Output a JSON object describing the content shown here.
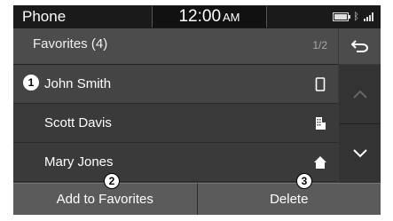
{
  "status_bar": {
    "title": "Phone",
    "time": "12:00",
    "ampm": "AM",
    "icons": [
      "battery-icon",
      "bluetooth-icon",
      "signal-icon"
    ]
  },
  "header": {
    "title": "Favorites (4)",
    "page_indicator": "1/2",
    "back_icon": "back-arrow-icon"
  },
  "contacts": [
    {
      "name": "John Smith",
      "type_icon": "mobile-phone-icon",
      "selected": true
    },
    {
      "name": "Scott Davis",
      "type_icon": "office-building-icon"
    },
    {
      "name": "Mary Jones",
      "type_icon": "home-icon"
    }
  ],
  "scroll": {
    "up_icon": "chevron-up-icon",
    "down_icon": "chevron-down-icon"
  },
  "buttons": {
    "add": "Add to Favorites",
    "delete": "Delete"
  },
  "callouts": [
    "1",
    "2",
    "3"
  ],
  "colors": {
    "background": "#3b3b3b",
    "status_bar": "#1a1a1a",
    "button": "#5b5b5b",
    "text": "#ffffff"
  }
}
